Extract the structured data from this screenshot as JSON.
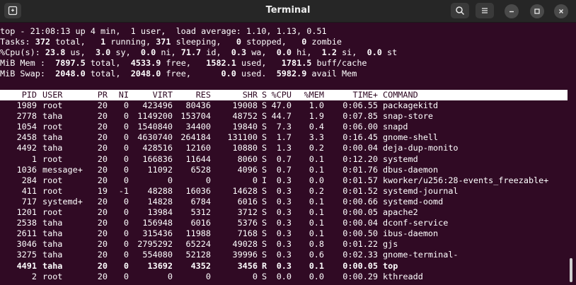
{
  "window": {
    "title": "Terminal",
    "icons": {
      "new_tab": "terminal-tab-icon",
      "search": "search-icon",
      "menu": "hamburger-menu-icon",
      "minimize": "minimize-icon",
      "maximize": "maximize-icon",
      "close": "close-icon"
    }
  },
  "summary": {
    "line1": "top - 21:08:13 up 4 min,  1 user,  load average: 1.10, 1.13, 0.51",
    "tasks": [
      {
        "t": "Tasks: ",
        "b": false
      },
      {
        "t": "372",
        "b": true
      },
      {
        "t": " total,   ",
        "b": false
      },
      {
        "t": "1",
        "b": true
      },
      {
        "t": " running, ",
        "b": false
      },
      {
        "t": "371",
        "b": true
      },
      {
        "t": " sleeping,   ",
        "b": false
      },
      {
        "t": "0",
        "b": true
      },
      {
        "t": " stopped,   ",
        "b": false
      },
      {
        "t": "0",
        "b": true
      },
      {
        "t": " zombie",
        "b": false
      }
    ],
    "cpu": [
      {
        "t": "%Cpu(s): ",
        "b": false
      },
      {
        "t": "23.8",
        "b": true
      },
      {
        "t": " us,  ",
        "b": false
      },
      {
        "t": "3.0",
        "b": true
      },
      {
        "t": " sy,  ",
        "b": false
      },
      {
        "t": "0.0",
        "b": true
      },
      {
        "t": " ni, ",
        "b": false
      },
      {
        "t": "71.7",
        "b": true
      },
      {
        "t": " id,  ",
        "b": false
      },
      {
        "t": "0.3",
        "b": true
      },
      {
        "t": " wa,  ",
        "b": false
      },
      {
        "t": "0.0",
        "b": true
      },
      {
        "t": " hi,  ",
        "b": false
      },
      {
        "t": "1.2",
        "b": true
      },
      {
        "t": " si,  ",
        "b": false
      },
      {
        "t": "0.0",
        "b": true
      },
      {
        "t": " st",
        "b": false
      }
    ],
    "mem": [
      {
        "t": "MiB Mem :  ",
        "b": false
      },
      {
        "t": "7897.5",
        "b": true
      },
      {
        "t": " total,  ",
        "b": false
      },
      {
        "t": "4533.9",
        "b": true
      },
      {
        "t": " free,   ",
        "b": false
      },
      {
        "t": "1582.1",
        "b": true
      },
      {
        "t": " used,   ",
        "b": false
      },
      {
        "t": "1781.5",
        "b": true
      },
      {
        "t": " buff/cache",
        "b": false
      }
    ],
    "swap": [
      {
        "t": "MiB Swap:  ",
        "b": false
      },
      {
        "t": "2048.0",
        "b": true
      },
      {
        "t": " total,  ",
        "b": false
      },
      {
        "t": "2048.0",
        "b": true
      },
      {
        "t": " free,      ",
        "b": false
      },
      {
        "t": "0.0",
        "b": true
      },
      {
        "t": " used.  ",
        "b": false
      },
      {
        "t": "5982.9",
        "b": true
      },
      {
        "t": " avail Mem",
        "b": false
      }
    ]
  },
  "table": {
    "headers": [
      "PID",
      "USER",
      "PR",
      "NI",
      "VIRT",
      "RES",
      "SHR",
      "S",
      "%CPU",
      "%MEM",
      "TIME+",
      "COMMAND"
    ],
    "rows": [
      [
        "1989",
        "root",
        "20",
        "0",
        "423496",
        "80436",
        "19008",
        "S",
        "47.0",
        "1.0",
        "0:06.55",
        "packagekitd"
      ],
      [
        "2778",
        "taha",
        "20",
        "0",
        "1149200",
        "153704",
        "48752",
        "S",
        "44.7",
        "1.9",
        "0:07.85",
        "snap-store"
      ],
      [
        "1054",
        "root",
        "20",
        "0",
        "1540840",
        "34400",
        "19840",
        "S",
        "7.3",
        "0.4",
        "0:06.00",
        "snapd"
      ],
      [
        "2458",
        "taha",
        "20",
        "0",
        "4630740",
        "264184",
        "131100",
        "S",
        "1.7",
        "3.3",
        "0:16.45",
        "gnome-shell"
      ],
      [
        "4492",
        "taha",
        "20",
        "0",
        "428516",
        "12160",
        "10880",
        "S",
        "1.3",
        "0.2",
        "0:00.04",
        "deja-dup-monito"
      ],
      [
        "1",
        "root",
        "20",
        "0",
        "166836",
        "11644",
        "8060",
        "S",
        "0.7",
        "0.1",
        "0:12.20",
        "systemd"
      ],
      [
        "1036",
        "message+",
        "20",
        "0",
        "11092",
        "6528",
        "4096",
        "S",
        "0.7",
        "0.1",
        "0:01.76",
        "dbus-daemon"
      ],
      [
        "284",
        "root",
        "20",
        "0",
        "0",
        "0",
        "0",
        "I",
        "0.3",
        "0.0",
        "0:01.57",
        "kworker/u256:28-events_freezable+"
      ],
      [
        "411",
        "root",
        "19",
        "-1",
        "48288",
        "16036",
        "14628",
        "S",
        "0.3",
        "0.2",
        "0:01.52",
        "systemd-journal"
      ],
      [
        "717",
        "systemd+",
        "20",
        "0",
        "14828",
        "6784",
        "6016",
        "S",
        "0.3",
        "0.1",
        "0:00.66",
        "systemd-oomd"
      ],
      [
        "1201",
        "root",
        "20",
        "0",
        "13984",
        "5312",
        "3712",
        "S",
        "0.3",
        "0.1",
        "0:00.05",
        "apache2"
      ],
      [
        "2538",
        "taha",
        "20",
        "0",
        "156948",
        "6016",
        "5376",
        "S",
        "0.3",
        "0.1",
        "0:00.04",
        "dconf-service"
      ],
      [
        "2611",
        "taha",
        "20",
        "0",
        "315436",
        "11988",
        "7168",
        "S",
        "0.3",
        "0.1",
        "0:00.50",
        "ibus-daemon"
      ],
      [
        "3046",
        "taha",
        "20",
        "0",
        "2795292",
        "65224",
        "49028",
        "S",
        "0.3",
        "0.8",
        "0:01.22",
        "gjs"
      ],
      [
        "3275",
        "taha",
        "20",
        "0",
        "554080",
        "52128",
        "39996",
        "S",
        "0.3",
        "0.6",
        "0:02.33",
        "gnome-terminal-"
      ],
      [
        "4491",
        "taha",
        "20",
        "0",
        "13692",
        "4352",
        "3456",
        "R",
        "0.3",
        "0.1",
        "0:00.05",
        "top"
      ],
      [
        "2",
        "root",
        "20",
        "0",
        "0",
        "0",
        "0",
        "S",
        "0.0",
        "0.0",
        "0:00.29",
        "kthreadd"
      ]
    ],
    "bold_row_pid": "4491"
  }
}
